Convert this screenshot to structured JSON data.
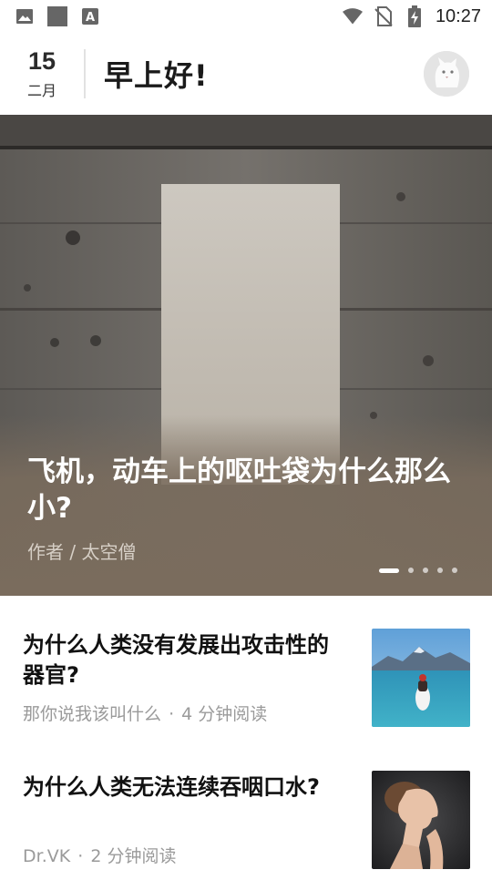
{
  "status_bar": {
    "time": "10:27",
    "left_icons": [
      "image-icon",
      "square-icon",
      "keyboard-a-icon"
    ],
    "right_icons": [
      "wifi-icon",
      "no-sim-icon",
      "battery-charging-icon"
    ]
  },
  "header": {
    "day": "15",
    "month": "二月",
    "greeting": "早上好!",
    "avatar": "cat-avatar-icon"
  },
  "hero": {
    "title": "飞机，动车上的呕吐袋为什么那么小?",
    "author": "作者 / 太空僧",
    "slide_count": 5,
    "active_slide": 1
  },
  "articles": [
    {
      "title": "为什么人类没有发展出攻击性的器官?",
      "author": "那你说我该叫什么",
      "separator": "·",
      "read_time": "4 分钟阅读",
      "thumbnail": "kayak-lake-image"
    },
    {
      "title": "为什么人类无法连续吞咽口水?",
      "author": "Dr.VK",
      "separator": "·",
      "read_time": "2 分钟阅读",
      "thumbnail": "woman-profile-image"
    }
  ]
}
